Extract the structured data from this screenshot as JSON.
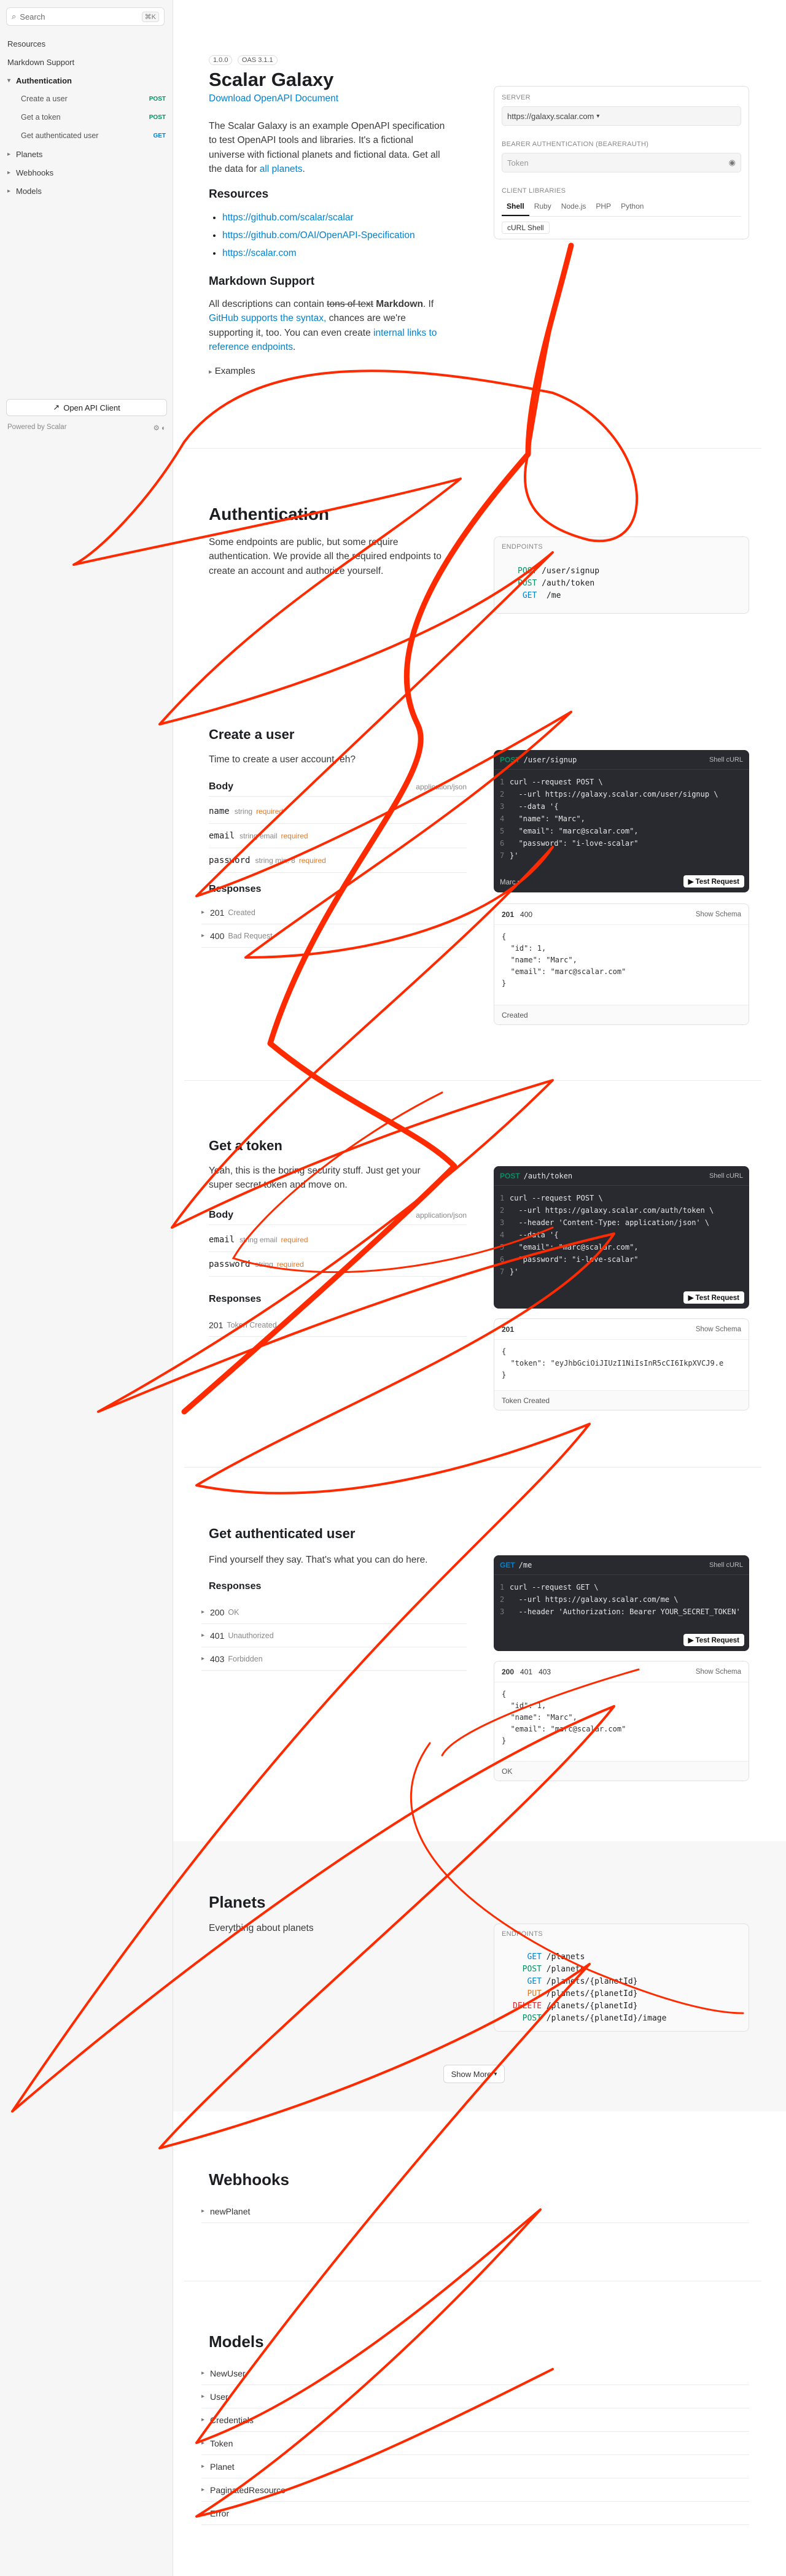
{
  "sidebar": {
    "search_placeholder": "Search",
    "search_shortcut": "⌘K",
    "items": [
      {
        "label": "Resources"
      },
      {
        "label": "Markdown Support"
      },
      {
        "label": "Authentication"
      },
      {
        "label": "Create a user",
        "method": "POST"
      },
      {
        "label": "Get a token",
        "method": "POST"
      },
      {
        "label": "Get authenticated user",
        "method": "GET"
      },
      {
        "label": "Planets"
      },
      {
        "label": "Webhooks"
      },
      {
        "label": "Models"
      }
    ],
    "open_client": "Open API Client",
    "powered_by": "Powered by Scalar"
  },
  "intro": {
    "version": "1.0.0",
    "oas": "OAS 3.1.1",
    "title": "Scalar Galaxy",
    "download": "Download OpenAPI Document",
    "desc_1": "The Scalar Galaxy is an example OpenAPI specification",
    "desc_2": "to test OpenAPI tools and libraries. It's a fictional",
    "desc_3": "universe with fictional planets and fictional data. Get all",
    "desc_4a": "the data for ",
    "desc_4_link": "all planets",
    "resources_title": "Resources",
    "links": [
      "https://github.com/scalar/scalar",
      "https://github.com/OAI/OpenAPI-Specification",
      "https://scalar.com"
    ],
    "markdown_title": "Markdown Support",
    "md_1a": "All descriptions can contain ",
    "md_1_strike": "tons of text",
    "md_1b": " Markdown",
    "md_1c": ". If",
    "md_2": "GitHub supports the syntax,",
    "md_2b": " chances are we're",
    "md_3a": "supporting it, too. You can even create ",
    "md_3_link": "internal links to",
    "md_4_link": "reference endpoints",
    "md_4b": ".",
    "examples": "Examples"
  },
  "config": {
    "server_label": "SERVER",
    "server_value": "https://galaxy.scalar.com",
    "auth_label": "BEARER AUTHENTICATION (BEARERAUTH)",
    "token_placeholder": "Token",
    "libs_label": "CLIENT LIBRARIES",
    "libs": [
      "Shell",
      "Ruby",
      "Node.js",
      "PHP",
      "Python"
    ],
    "lib_variant": "cURL Shell"
  },
  "auth": {
    "title": "Authentication",
    "desc_1": "Some endpoints are public, but some require",
    "desc_2": "authentication. We provide all the required endpoints to",
    "desc_3": "create an account and authorize yourself.",
    "endpoints_label": "ENDPOINTS",
    "endpoints": [
      {
        "method": "POST",
        "path": "/user/signup"
      },
      {
        "method": "POST",
        "path": "/auth/token"
      },
      {
        "method": "GET",
        "path": "/me"
      }
    ]
  },
  "create_user": {
    "title": "Create a user",
    "desc": "Time to create a user account, eh?",
    "body": "Body",
    "content_type": "application/json",
    "params": [
      {
        "name": "name",
        "type": "string",
        "req": "required"
      },
      {
        "name": "email",
        "type": "string email",
        "req": "required"
      },
      {
        "name": "password",
        "type": "string min: 8",
        "req": "required"
      }
    ],
    "responses_title": "Responses",
    "responses": [
      {
        "code": "201",
        "desc": "Created"
      },
      {
        "code": "400",
        "desc": "Bad Request"
      }
    ],
    "req_method": "POST",
    "req_path": "/user/signup",
    "req_lang": "Shell cURL",
    "code": [
      "curl --request POST \\",
      "  --url https://galaxy.scalar.com/user/signup \\",
      "  --data '{",
      "  \"name\": \"Marc\",",
      "  \"email\": \"marc@scalar.com\",",
      "  \"password\": \"i-love-scalar\"",
      "}'"
    ],
    "example": "Marc",
    "test": "Test Request",
    "resp_tabs": [
      "201",
      "400"
    ],
    "show_schema": "Show Schema",
    "resp_json": [
      "{",
      "  \"id\": 1,",
      "  \"name\": \"Marc\",",
      "  \"email\": \"marc@scalar.com\"",
      "}"
    ],
    "resp_foot": "Created"
  },
  "get_token": {
    "title": "Get a token",
    "desc_1": "Yeah, this is the boring security stuff. Just get your",
    "desc_2": "super secret token and move on.",
    "body": "Body",
    "content_type": "application/json",
    "params": [
      {
        "name": "email",
        "type": "string email",
        "req": "required"
      },
      {
        "name": "password",
        "type": "string",
        "req": "required"
      }
    ],
    "responses_title": "Responses",
    "responses": [
      {
        "code": "201",
        "desc": "Token Created"
      }
    ],
    "req_method": "POST",
    "req_path": "/auth/token",
    "req_lang": "Shell cURL",
    "code": [
      "curl --request POST \\",
      "  --url https://galaxy.scalar.com/auth/token \\",
      "  --header 'Content-Type: application/json' \\",
      "  --data '{",
      "  \"email\": \"marc@scalar.com\",",
      "  \"password\": \"i-love-scalar\"",
      "}'"
    ],
    "test": "Test Request",
    "resp_tabs": [
      "201"
    ],
    "show_schema": "Show Schema",
    "resp_json": [
      "{",
      "  \"token\": \"eyJhbGciOiJIUzI1NiIsInR5cCI6IkpXVCJ9.e",
      "}"
    ],
    "resp_foot": "Token Created"
  },
  "me": {
    "title": "Get authenticated user",
    "desc": "Find yourself they say. That's what you can do here.",
    "responses_title": "Responses",
    "responses": [
      {
        "code": "200",
        "desc": "OK"
      },
      {
        "code": "401",
        "desc": "Unauthorized"
      },
      {
        "code": "403",
        "desc": "Forbidden"
      }
    ],
    "req_method": "GET",
    "req_path": "/me",
    "req_lang": "Shell cURL",
    "code": [
      "curl --request GET \\",
      "  --url https://galaxy.scalar.com/me \\",
      "  --header 'Authorization: Bearer YOUR_SECRET_TOKEN'"
    ],
    "test": "Test Request",
    "resp_tabs": [
      "200",
      "401",
      "403"
    ],
    "show_schema": "Show Schema",
    "resp_json": [
      "{",
      "  \"id\": 1,",
      "  \"name\": \"Marc\",",
      "  \"email\": \"marc@scalar.com\"",
      "}"
    ],
    "resp_foot": "OK"
  },
  "planets": {
    "title": "Planets",
    "desc": "Everything about planets",
    "endpoints_label": "ENDPOINTS",
    "endpoints": [
      {
        "method": "GET",
        "path": "/planets"
      },
      {
        "method": "POST",
        "path": "/planets"
      },
      {
        "method": "GET",
        "path": "/planets/{planetId}"
      },
      {
        "method": "PUT",
        "path": "/planets/{planetId}"
      },
      {
        "method": "DELETE",
        "path": "/planets/{planetId}"
      },
      {
        "method": "POST",
        "path": "/planets/{planetId}/image"
      }
    ],
    "show_more": "Show More"
  },
  "webhooks": {
    "title": "Webhooks",
    "items": [
      "newPlanet"
    ]
  },
  "models": {
    "title": "Models",
    "items": [
      "NewUser",
      "User",
      "Credentials",
      "Token",
      "Planet",
      "PaginatedResource",
      "Error"
    ]
  },
  "colors": {
    "post": "#069061",
    "get": "#0082d0",
    "put": "#e07b2c",
    "delete": "#d6292b",
    "link": "#0082d0",
    "scribble": "#ff2a00"
  }
}
